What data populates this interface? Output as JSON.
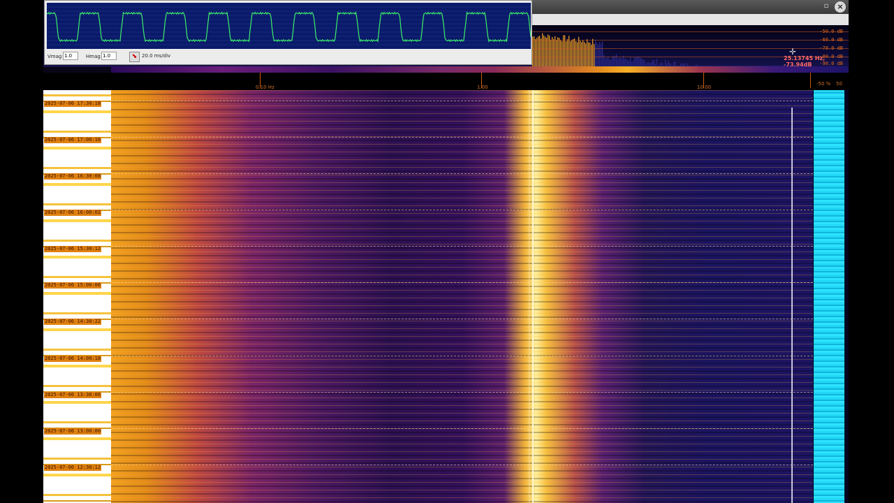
{
  "window": {
    "minimize_icon": "minimize-icon",
    "close_icon": "close-icon",
    "minimize_glyph": "▫",
    "close_glyph": "×"
  },
  "spectrum": {
    "db_levels": [
      "-50.0 dB",
      "-60.0 dB",
      "-70.0 dB",
      "-80.0 dB",
      "-90.0 dB"
    ],
    "cursor_readout": "25.13745 Hz, -73.94dB"
  },
  "axis": {
    "ticks": [
      "0.10 Hz",
      "1.00",
      "10.00"
    ],
    "percent_label": "-50 %",
    "percent_max": "50"
  },
  "waterfall": {
    "timestamps": [
      "2025-07-06 17:30:18",
      "2025-07-06 17:00:16",
      "2025-07-06 16:30:08",
      "2025-07-06 16:00:02",
      "2025-07-06 15:30:12",
      "2025-07-06 15:00:06",
      "2025-07-06 14:30:22",
      "2025-07-06 14:00:18",
      "2025-07-06 13:30:06",
      "2025-07-06 13:00:00",
      "2025-07-06 12:30:12"
    ]
  },
  "scope": {
    "vmag_label": "Vmag",
    "vmag_value": "1.0",
    "hmag_label": "Hmag",
    "hmag_value": "1.0",
    "timebase": "20.0 ms/div",
    "trace_color": "#3cf06a",
    "background_color": "#0a1a6a"
  }
}
